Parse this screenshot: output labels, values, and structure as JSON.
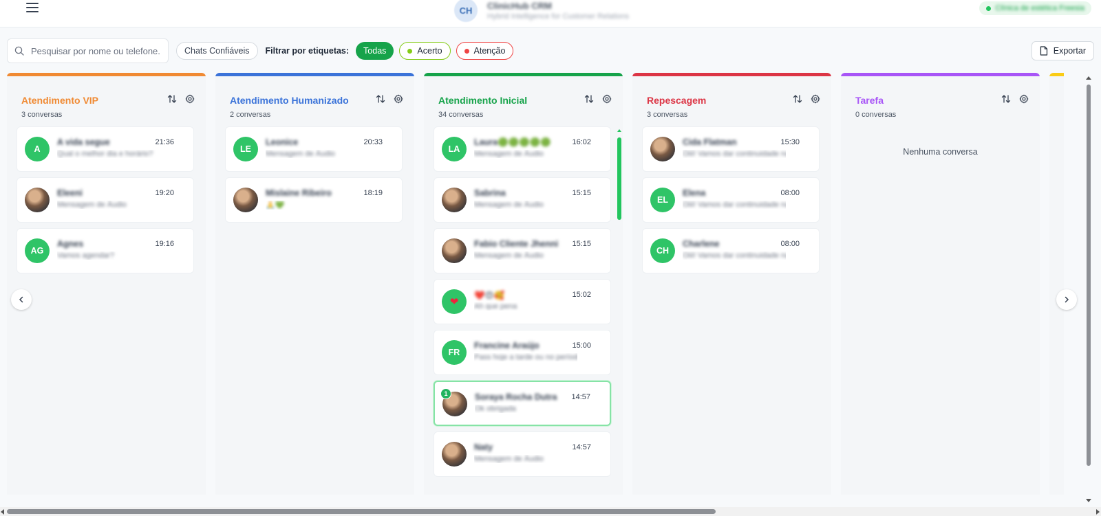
{
  "header": {
    "logo_text": "CH",
    "app_title": "ClinicHub CRM",
    "app_subtitle": "Hybrid Intelligence for Customer Relations",
    "clinic_name": "Clínica de estética Freesia",
    "clinic_status_color": "#22c55e"
  },
  "toolbar": {
    "search_placeholder": "Pesquisar por nome ou telefone...",
    "trusted_chats_label": "Chats Confiáveis",
    "filter_label": "Filtrar por etiquetas:",
    "tags": [
      {
        "label": "Todas",
        "color": "#16a34a"
      },
      {
        "label": "Acerto",
        "color": "#84cc16"
      },
      {
        "label": "Atenção",
        "color": "#ef4444"
      }
    ],
    "export_label": "Exportar"
  },
  "columns": [
    {
      "title": "Atendimento VIP",
      "color": "#f08a33",
      "count_label": "3 conversas",
      "cards": [
        {
          "initials": "A",
          "avatar": "initials",
          "name": "A vida segue",
          "message": "Qual o melhor dia e horário?",
          "time": "21:36"
        },
        {
          "initials": "",
          "avatar": "photo",
          "name": "Eleeni",
          "message": "Mensagem de Áudio",
          "time": "19:20"
        },
        {
          "initials": "AG",
          "avatar": "initials",
          "name": "Agnes",
          "message": "Vamos agendar?",
          "time": "19:16"
        }
      ]
    },
    {
      "title": "Atendimento Humanizado",
      "color": "#3b73d9",
      "count_label": "2 conversas",
      "cards": [
        {
          "initials": "LE",
          "avatar": "initials",
          "name": "Leonice",
          "message": "Mensagem de Áudio",
          "time": "20:33"
        },
        {
          "initials": "",
          "avatar": "photo",
          "name": "Mislaine Ribeiro",
          "message": "🙏💚",
          "time": "18:19"
        }
      ]
    },
    {
      "title": "Atendimento Inicial",
      "color": "#16a34a",
      "count_label": "34 conversas",
      "cards": [
        {
          "initials": "LA",
          "avatar": "initials",
          "name": "Laura🟢🟢🟢🟢🟢",
          "message": "Mensagem de Áudio",
          "time": "16:02"
        },
        {
          "initials": "",
          "avatar": "photo",
          "name": "Sabrina",
          "message": "Mensagem de Áudio",
          "time": "15:15"
        },
        {
          "initials": "",
          "avatar": "photo",
          "name": "Fabio Cliente Jhenni",
          "message": "Mensagem de Áudio",
          "time": "15:15"
        },
        {
          "initials": "❤",
          "avatar": "heart",
          "name": "❤️😍🥰",
          "message": "Ah que pena",
          "time": "15:02"
        },
        {
          "initials": "FR",
          "avatar": "initials",
          "name": "Francine Araújo",
          "message": "Pass hoje a tarde ou no período...",
          "time": "15:00"
        },
        {
          "initials": "",
          "avatar": "photo",
          "name": "Soraya Rocha Dutra",
          "message": "Ok obrigada",
          "time": "14:57",
          "unread": "1"
        },
        {
          "initials": "",
          "avatar": "photo",
          "name": "Naty",
          "message": "Mensagem de Áudio",
          "time": "14:57"
        }
      ]
    },
    {
      "title": "Repescagem",
      "color": "#dc3545",
      "count_label": "3 conversas",
      "cards": [
        {
          "initials": "",
          "avatar": "photo",
          "name": "Cida Flatman",
          "message": "Oiii! Vamos dar continuidade na ...",
          "time": "15:30"
        },
        {
          "initials": "EL",
          "avatar": "initials",
          "name": "Elena",
          "message": "Oiii! Vamos dar continuidade na ...",
          "time": "08:00"
        },
        {
          "initials": "CH",
          "avatar": "initials",
          "name": "Charlene",
          "message": "Oiii! Vamos dar continuidade na ...",
          "time": "08:00"
        }
      ]
    },
    {
      "title": "Tarefa",
      "color": "#a855f7",
      "count_label": "0 conversas",
      "empty_label": "Nenhuma conversa",
      "cards": []
    }
  ],
  "partial_column_color": "#facc15"
}
